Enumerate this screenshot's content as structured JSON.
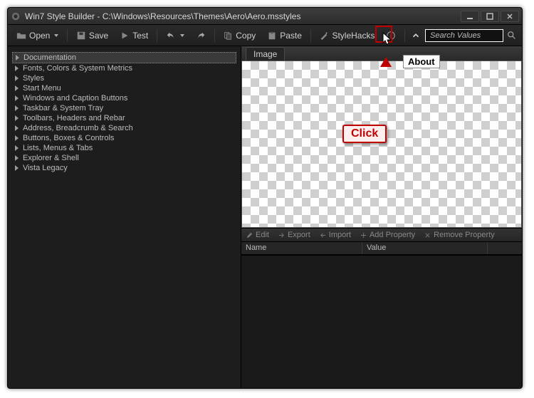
{
  "window": {
    "title": "Win7 Style Builder - C:\\Windows\\Resources\\Themes\\Aero\\Aero.msstyles"
  },
  "toolbar": {
    "open": "Open",
    "save": "Save",
    "test": "Test",
    "copy": "Copy",
    "paste": "Paste",
    "stylehacks": "StyleHacks"
  },
  "search": {
    "placeholder": "Search Values"
  },
  "tree": {
    "items": [
      {
        "label": "Documentation",
        "selected": true
      },
      {
        "label": "Fonts, Colors & System Metrics",
        "selected": false
      },
      {
        "label": "Styles",
        "selected": false
      },
      {
        "label": "Start Menu",
        "selected": false
      },
      {
        "label": "Windows and Caption Buttons",
        "selected": false
      },
      {
        "label": "Taskbar & System Tray",
        "selected": false
      },
      {
        "label": "Toolbars, Headers and Rebar",
        "selected": false
      },
      {
        "label": "Address, Breadcrumb & Search",
        "selected": false
      },
      {
        "label": "Buttons, Boxes & Controls",
        "selected": false
      },
      {
        "label": "Lists, Menus & Tabs",
        "selected": false
      },
      {
        "label": "Explorer & Shell",
        "selected": false
      },
      {
        "label": "Vista Legacy",
        "selected": false
      }
    ]
  },
  "preview": {
    "tab": "Image"
  },
  "proptoolbar": {
    "edit": "Edit",
    "export": "Export",
    "import": "Import",
    "add": "Add Property",
    "remove": "Remove Property"
  },
  "propcols": {
    "name": "Name",
    "value": "Value"
  },
  "annotations": {
    "about": "About",
    "click": "Click"
  }
}
